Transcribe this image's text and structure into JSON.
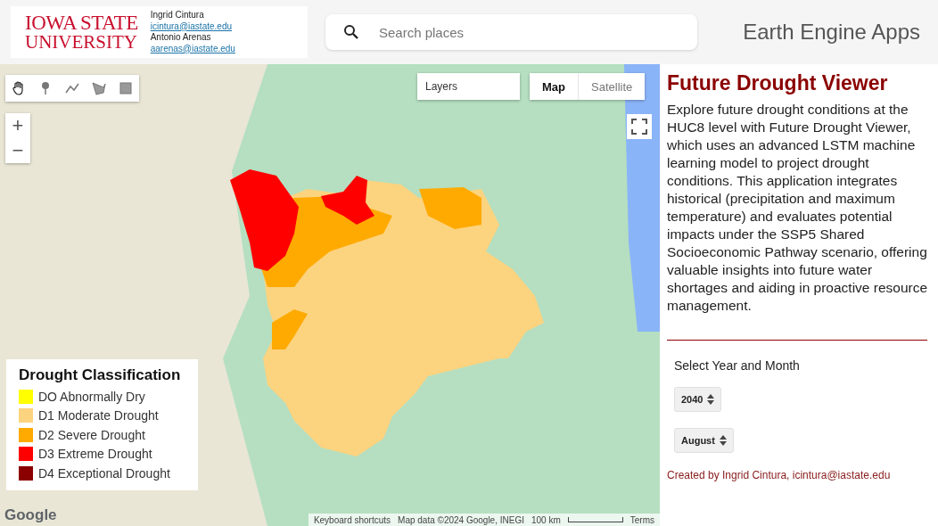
{
  "header": {
    "logo": {
      "line_1": "IOWA STATE",
      "line_2": "UNIVERSITY"
    },
    "authors": [
      {
        "kind": "name",
        "text": "Ingrid Cintura"
      },
      {
        "kind": "email",
        "text": "icintura@iastate.edu"
      },
      {
        "kind": "name",
        "text": "Antonio Arenas"
      },
      {
        "kind": "email",
        "text": "aarenas@iastate.edu"
      }
    ],
    "search": {
      "placeholder": "Search places"
    },
    "app_title": "Earth Engine Apps"
  },
  "map": {
    "zoom_in": "+",
    "zoom_out": "−",
    "layers": "Layers",
    "map_types": [
      {
        "label": "Map",
        "selected": true
      },
      {
        "label": "Satellite",
        "selected": false
      }
    ],
    "legend": {
      "title": "Drought Classification",
      "items": [
        {
          "label": "DO Abnormally Dry",
          "color": "#ffff00"
        },
        {
          "label": "D1 Moderate Drought",
          "color": "#fcd37f"
        },
        {
          "label": "D2 Severe Drought",
          "color": "#ffaa00"
        },
        {
          "label": "D3 Extreme Drought",
          "color": "#ff0000"
        },
        {
          "label": "D4 Exceptional Drought",
          "color": "#8b0000"
        }
      ]
    },
    "google_logo": "Google",
    "attribution": [
      "Keyboard shortcuts",
      "Map data ©2024 Google, INEGI",
      "100 km",
      "Terms"
    ]
  },
  "panel": {
    "title": "Future Drought Viewer",
    "description": "Explore future drought conditions at the HUC8 level with Future Drought Viewer, which uses an advanced LSTM machine learning model to project drought conditions. This application integrates historical (precipitation and maximum temperature) and evaluates potential impacts under the SSP5 Shared Socioeconomic Pathway scenario, offering valuable insights into future water shortages and aiding in proactive resource management.",
    "select_label": "Select Year and Month",
    "selects": [
      {
        "value": "2040"
      },
      {
        "value": "August"
      }
    ],
    "credit": "Created by Ingrid Cintura, icintura@iastate.edu"
  }
}
